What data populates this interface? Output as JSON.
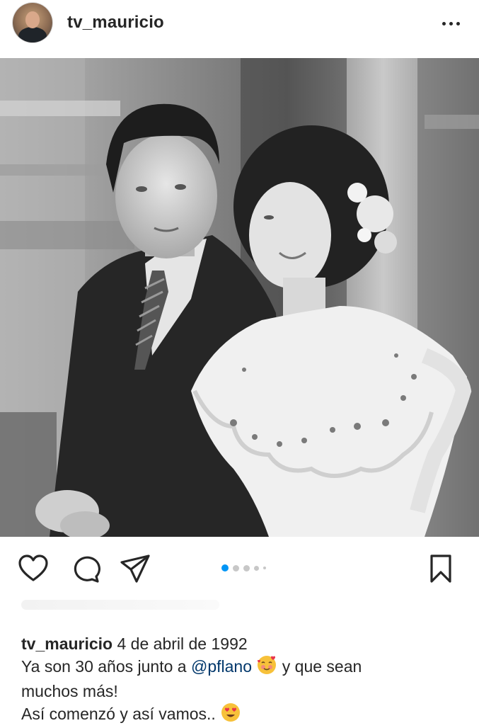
{
  "header": {
    "username": "tv_mauricio",
    "avatar_icon": "profile-avatar",
    "more_icon": "more-options-icon"
  },
  "post": {
    "image_style": "black-and-white wedding photo",
    "carousel": {
      "total": 5,
      "active_index": 0,
      "active_color": "#0095f6"
    }
  },
  "actions": {
    "like_icon": "heart-icon",
    "comment_icon": "comment-icon",
    "share_icon": "send-icon",
    "save_icon": "bookmark-icon"
  },
  "caption": {
    "username": "tv_mauricio",
    "line1_text": " 4 de abril de 1992",
    "line2_prefix": "Ya son 30 años junto a ",
    "mention": "@pflano",
    "line2_suffix": " y que sean",
    "line3": "muchos más!",
    "line4": "Así comenzó y así vamos.. ",
    "emoji1": "smiling-face-with-hearts",
    "emoji2": "heart-eyes"
  },
  "colors": {
    "text": "#262626",
    "mention": "#00376b",
    "accent_blue": "#0095f6"
  }
}
